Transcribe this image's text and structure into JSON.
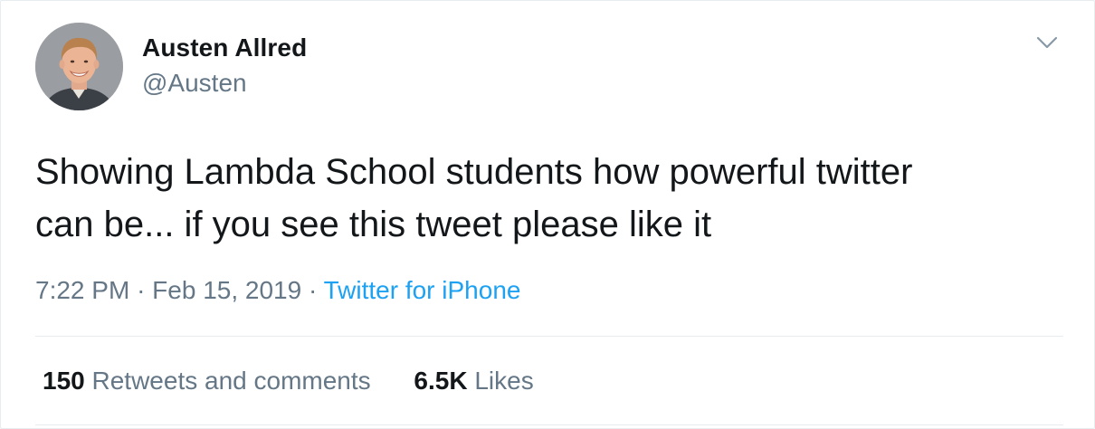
{
  "author": {
    "name": "Austen Allred",
    "handle": "@Austen"
  },
  "tweet": {
    "text_line1": "Showing Lambda School students how powerful twitter",
    "text_line2": "can be... if you see this tweet please like it"
  },
  "meta": {
    "time": "7:22 PM",
    "separator": "·",
    "date": "Feb 15, 2019",
    "source": "Twitter for iPhone"
  },
  "stats": {
    "retweets_count": "150",
    "retweets_label": "Retweets and comments",
    "likes_count": "6.5K",
    "likes_label": "Likes"
  },
  "colors": {
    "link": "#1da1f2",
    "secondary_text": "#657786",
    "divider": "#e6ecf0"
  },
  "icons": {
    "menu": "chevron-down-icon",
    "avatar": "avatar"
  }
}
